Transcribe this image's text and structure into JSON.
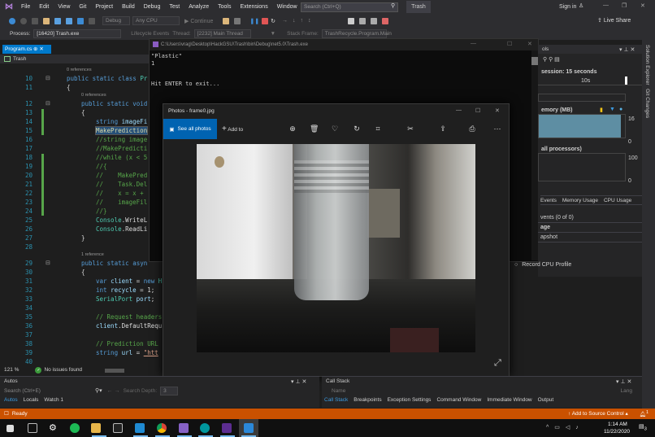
{
  "menu": {
    "items": [
      "File",
      "Edit",
      "View",
      "Git",
      "Project",
      "Build",
      "Debug",
      "Test",
      "Analyze",
      "Tools",
      "Extensions",
      "Window",
      "Help"
    ],
    "search_placeholder": "Search (Ctrl+Q)",
    "solution_name": "Trash",
    "sign_in": "Sign in",
    "live_share": "Live Share"
  },
  "toolbar": {
    "config": "Debug",
    "platform": "Any CPU",
    "continue": "Continue"
  },
  "procbar": {
    "process_label": "Process:",
    "process": "[16420] Trash.exe",
    "lifecycle": "Lifecycle Events",
    "thread_label": "Thread:",
    "thread": "[2232] Main Thread",
    "stack_label": "Stack Frame:",
    "stack": "TrashRecycle.Program.Main"
  },
  "editor": {
    "tab": "Program.cs",
    "nav": "Trash",
    "zoom": "121 %",
    "issues": "No issues found",
    "refs": [
      {
        "text": "0 references",
        "line": "10"
      },
      {
        "text": "0 references",
        "line": "12"
      },
      {
        "text": "1 reference",
        "line": "29"
      }
    ],
    "lines": [
      {
        "n": "10",
        "i": 0,
        "t": [
          [
            "public static class ",
            "kw"
          ],
          [
            "Pr",
            "ty"
          ]
        ]
      },
      {
        "n": "11",
        "i": 0,
        "t": [
          [
            "{",
            "pl"
          ]
        ]
      },
      {
        "n": "12",
        "i": 1,
        "t": [
          [
            "public static void",
            "kw"
          ]
        ]
      },
      {
        "n": "13",
        "i": 1,
        "t": [
          [
            "{",
            "pl"
          ]
        ]
      },
      {
        "n": "14",
        "i": 2,
        "t": [
          [
            "string ",
            "kw"
          ],
          [
            "imageFi",
            "id"
          ]
        ]
      },
      {
        "n": "15",
        "i": 2,
        "t": [
          [
            "MakePrediction",
            "fn"
          ]
        ],
        "hl": true
      },
      {
        "n": "16",
        "i": 2,
        "t": [
          [
            "//string image",
            "cm"
          ]
        ]
      },
      {
        "n": "17",
        "i": 2,
        "t": [
          [
            "//MakePredicti",
            "cm"
          ]
        ]
      },
      {
        "n": "18",
        "i": 2,
        "t": [
          [
            "//while (x < 5",
            "cm"
          ]
        ]
      },
      {
        "n": "19",
        "i": 2,
        "t": [
          [
            "//{",
            "cm"
          ]
        ]
      },
      {
        "n": "20",
        "i": 2,
        "t": [
          [
            "//    MakePred",
            "cm"
          ]
        ]
      },
      {
        "n": "21",
        "i": 2,
        "t": [
          [
            "//    Task.Del",
            "cm"
          ]
        ]
      },
      {
        "n": "22",
        "i": 2,
        "t": [
          [
            "//    x = x +",
            "cm"
          ]
        ]
      },
      {
        "n": "23",
        "i": 2,
        "t": [
          [
            "//    imageFil",
            "cm"
          ]
        ]
      },
      {
        "n": "24",
        "i": 2,
        "t": [
          [
            "//}",
            "cm"
          ]
        ]
      },
      {
        "n": "25",
        "i": 2,
        "t": [
          [
            "Console",
            "ty"
          ],
          [
            ".WriteL",
            "pl"
          ]
        ]
      },
      {
        "n": "26",
        "i": 2,
        "t": [
          [
            "Console",
            "ty"
          ],
          [
            ".ReadLi",
            "pl"
          ]
        ]
      },
      {
        "n": "27",
        "i": 1,
        "t": [
          [
            "}",
            "pl"
          ]
        ]
      },
      {
        "n": "28",
        "i": 1,
        "t": []
      },
      {
        "n": "29",
        "i": 1,
        "t": [
          [
            "public static asyn",
            "kw"
          ]
        ]
      },
      {
        "n": "30",
        "i": 1,
        "t": [
          [
            "{",
            "pl"
          ]
        ]
      },
      {
        "n": "31",
        "i": 2,
        "t": [
          [
            "var ",
            "kw"
          ],
          [
            "client",
            "id"
          ],
          [
            " = ",
            "pl"
          ],
          [
            "new ",
            "kw"
          ],
          [
            "H",
            "ty"
          ]
        ]
      },
      {
        "n": "32",
        "i": 2,
        "t": [
          [
            "int ",
            "kw"
          ],
          [
            "recycle",
            "id"
          ],
          [
            " = 1;",
            "pl"
          ]
        ]
      },
      {
        "n": "33",
        "i": 2,
        "t": [
          [
            "SerialPort ",
            "ty"
          ],
          [
            "port",
            "id"
          ],
          [
            ";",
            "pl"
          ]
        ]
      },
      {
        "n": "34",
        "i": 2,
        "t": []
      },
      {
        "n": "35",
        "i": 2,
        "t": [
          [
            "// Request headers",
            "cm"
          ]
        ]
      },
      {
        "n": "36",
        "i": 2,
        "t": [
          [
            "client",
            "id"
          ],
          [
            ".DefaultRequ",
            "pl"
          ]
        ]
      },
      {
        "n": "37",
        "i": 2,
        "t": []
      },
      {
        "n": "38",
        "i": 2,
        "t": [
          [
            "// Prediction URL",
            "cm"
          ]
        ]
      },
      {
        "n": "39",
        "i": 2,
        "t": [
          [
            "string ",
            "kw"
          ],
          [
            "url",
            "id"
          ],
          [
            " = ",
            "pl"
          ],
          [
            "\"htt",
            "st"
          ]
        ]
      },
      {
        "n": "40",
        "i": 2,
        "t": []
      }
    ]
  },
  "console": {
    "title": "C:\\Users\\vrag\\Desktop\\HackGSU\\Trash\\bin\\Debug\\net5.0\\Trash.exe",
    "lines": [
      "\"Plastic\"",
      "1",
      "",
      "",
      "Hit ENTER to exit..."
    ]
  },
  "photos": {
    "title": "Photos - frame0.jpg",
    "see_all": "See all photos",
    "add_to": "Add to"
  },
  "diag": {
    "title": "ols",
    "session": "session: 15 seconds",
    "time_tick": "10s",
    "memory": "emory (MB)",
    "mem_max": "16",
    "mem_min": "0",
    "mem_fill_percent": 95,
    "cpu": "all processors)",
    "cpu_max": "100",
    "cpu_min": "0",
    "tabs": [
      "Events",
      "Memory Usage",
      "CPU Usage"
    ],
    "items": [
      "vents (0 of 0)",
      "age",
      "apshot"
    ],
    "record": "Record CPU Profile"
  },
  "side_tabs": [
    "Solution Explorer",
    "Git Changes"
  ],
  "autos": {
    "title": "Autos",
    "search_placeholder": "Search (Ctrl+E)",
    "depth_label": "Search Depth:",
    "depth": "3",
    "tabs": [
      "Autos",
      "Locals",
      "Watch 1"
    ]
  },
  "callstack": {
    "title": "Call Stack",
    "col_name": "Name",
    "col_lang": "Lang",
    "tabs": [
      "Call Stack",
      "Breakpoints",
      "Exception Settings",
      "Command Window",
      "Immediate Window",
      "Output"
    ]
  },
  "status": {
    "text": "Ready",
    "source_control": "Add to Source Control",
    "notifications": "1"
  },
  "taskbar": {
    "time": "1:14 AM",
    "date": "11/22/2020",
    "notif_count": "3"
  }
}
